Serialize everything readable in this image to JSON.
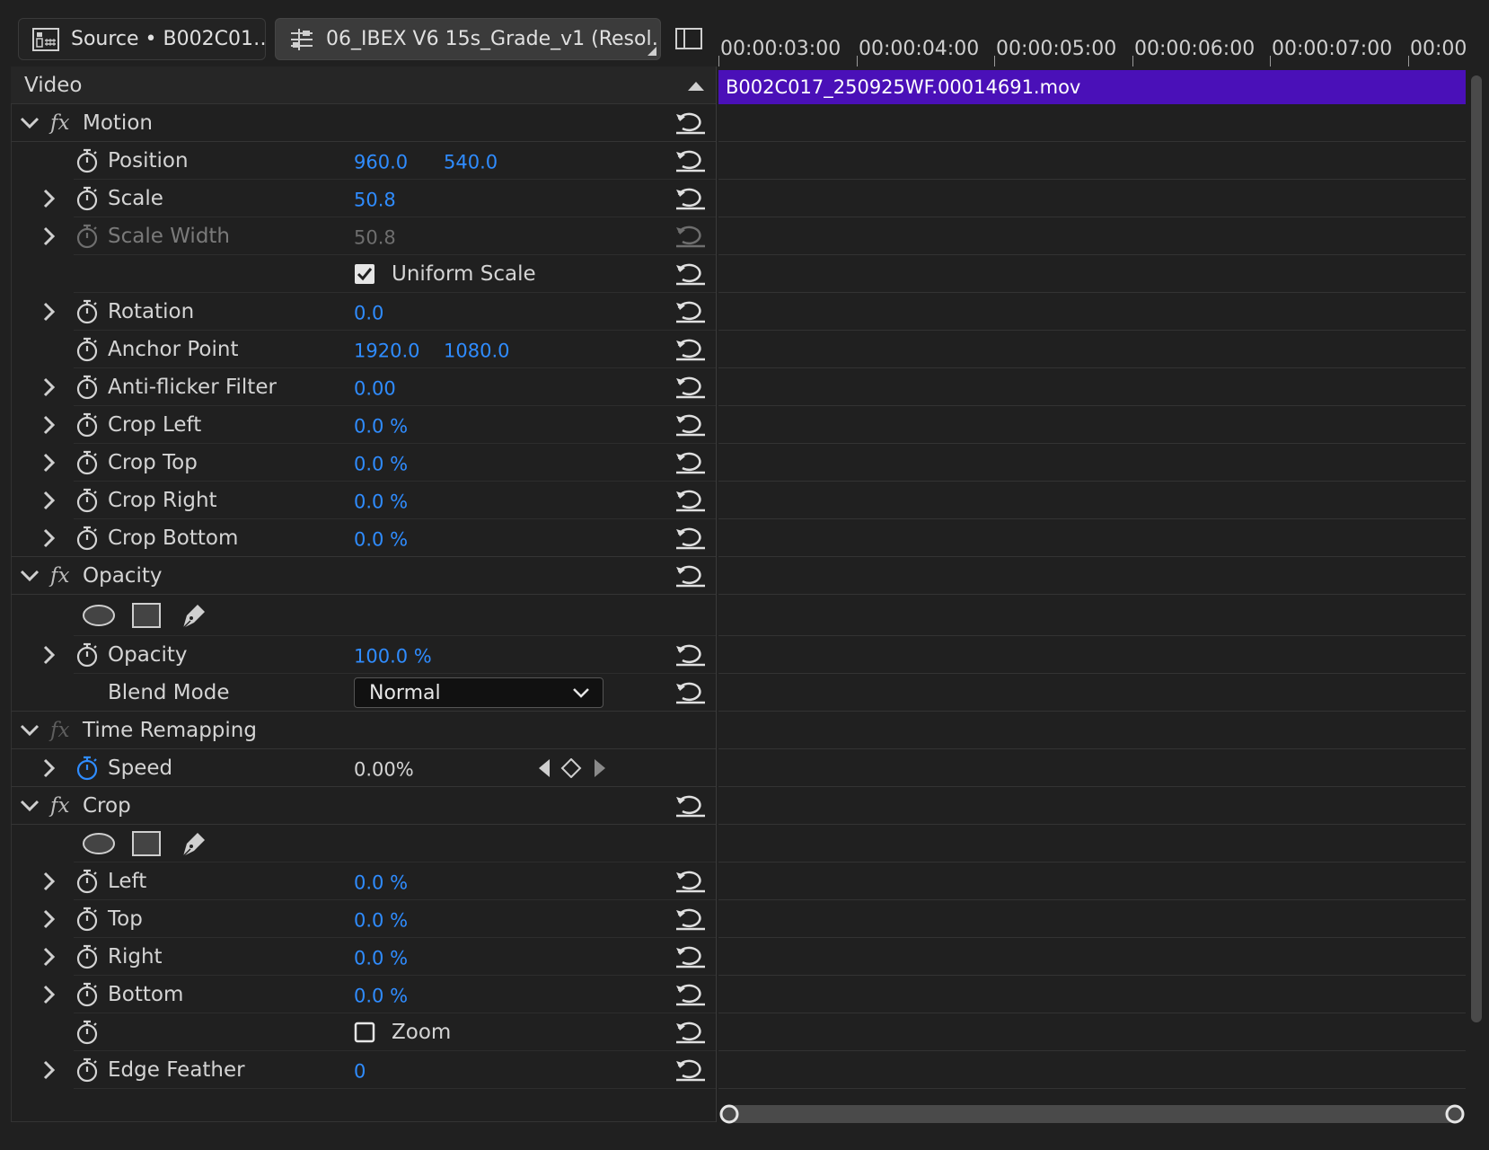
{
  "tabs": [
    {
      "label": "Source • B002C01…",
      "icon": "source-monitor-icon"
    },
    {
      "label": "06_IBEX V6 15s_Grade_v1 (Resol…",
      "icon": "sequence-icon"
    }
  ],
  "panel_toggle_icon": "panel-layout-icon",
  "section": {
    "label": "Video"
  },
  "effects": {
    "motion": {
      "name": "Motion",
      "position": {
        "label": "Position",
        "x": "960.0",
        "y": "540.0"
      },
      "scale": {
        "label": "Scale",
        "value": "50.8"
      },
      "scale_width": {
        "label": "Scale Width",
        "value": "50.8"
      },
      "uniform_scale": {
        "label": "Uniform Scale",
        "checked": true
      },
      "rotation": {
        "label": "Rotation",
        "value": "0.0"
      },
      "anchor_point": {
        "label": "Anchor Point",
        "x": "1920.0",
        "y": "1080.0"
      },
      "anti_flicker": {
        "label": "Anti-flicker Filter",
        "value": "0.00"
      },
      "crop_left": {
        "label": "Crop Left",
        "value": "0.0 %"
      },
      "crop_top": {
        "label": "Crop Top",
        "value": "0.0 %"
      },
      "crop_right": {
        "label": "Crop Right",
        "value": "0.0 %"
      },
      "crop_bottom": {
        "label": "Crop Bottom",
        "value": "0.0 %"
      }
    },
    "opacity": {
      "name": "Opacity",
      "opacity": {
        "label": "Opacity",
        "value": "100.0 %"
      },
      "blend_mode": {
        "label": "Blend Mode",
        "value": "Normal"
      }
    },
    "time_remapping": {
      "name": "Time Remapping",
      "speed": {
        "label": "Speed",
        "value": "0.00%"
      }
    },
    "crop": {
      "name": "Crop",
      "left": {
        "label": "Left",
        "value": "0.0 %"
      },
      "top": {
        "label": "Top",
        "value": "0.0 %"
      },
      "right": {
        "label": "Right",
        "value": "0.0 %"
      },
      "bottom": {
        "label": "Bottom",
        "value": "0.0 %"
      },
      "zoom": {
        "label": "Zoom",
        "checked": false
      },
      "edge_feather": {
        "label": "Edge Feather",
        "value": "0"
      }
    }
  },
  "timeline": {
    "ticks": [
      "00:00:03:00",
      "00:00:04:00",
      "00:00:05:00",
      "00:00:06:00",
      "00:00:07:00",
      "00:00:0"
    ],
    "clip_name": "B002C017_250925WF.00014691.mov",
    "clip_color": "#4a10b8"
  },
  "colors": {
    "value_blue": "#2f8cff",
    "background": "#202020"
  }
}
